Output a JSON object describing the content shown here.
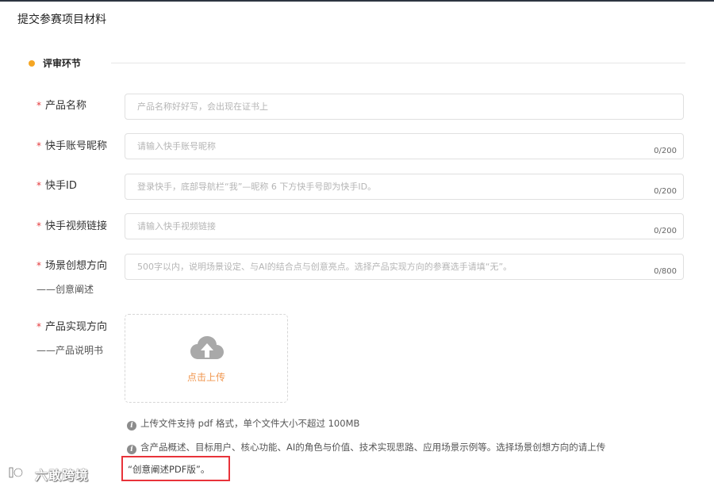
{
  "page": {
    "title": "提交参赛项目材料"
  },
  "section": {
    "title": "评审环节",
    "dot_color": "#f5a623"
  },
  "fields": [
    {
      "label": "产品名称",
      "required": "*",
      "placeholder": "产品名称好好写，会出现在证书上",
      "counter": ""
    },
    {
      "label": "快手账号昵称",
      "required": "*",
      "placeholder": "请输入快手账号昵称",
      "counter": "0/200"
    },
    {
      "label": "快手ID",
      "required": "*",
      "placeholder": "登录快手，底部导航栏“我”—昵称 6 下方快手号即为快手ID。",
      "counter": "0/200"
    },
    {
      "label": "快手视频链接",
      "required": "*",
      "placeholder": "请输入快手视频链接",
      "counter": "0/200"
    },
    {
      "label": "场景创想方向",
      "label_sub": "——创意阐述",
      "required": "*",
      "placeholder": "500字以内，说明场景设定、与AI的结合点与创意亮点。选择产品实现方向的参赛选手请填“无”。",
      "counter": "0/800"
    }
  ],
  "upload_field": {
    "label": "产品实现方向",
    "label_sub": "——产品说明书",
    "required": "*",
    "button_label": "点击上传",
    "icon": "cloud-upload-icon"
  },
  "hints": {
    "format": "上传文件支持 pdf 格式，单个文件大小不超过 100MB",
    "content": "含产品概述、目标用户、核心功能、AI的角色与价值、技术实现思路、应用场景示例等。选择场景创想方向的请上传",
    "highlight": "“创意阐述PDF版”。",
    "icon": "info-icon"
  },
  "watermark": {
    "text": "六敢跨境"
  },
  "colors": {
    "required": "#e4393c",
    "accent": "#f0964e",
    "highlight_border": "#e8333a"
  }
}
